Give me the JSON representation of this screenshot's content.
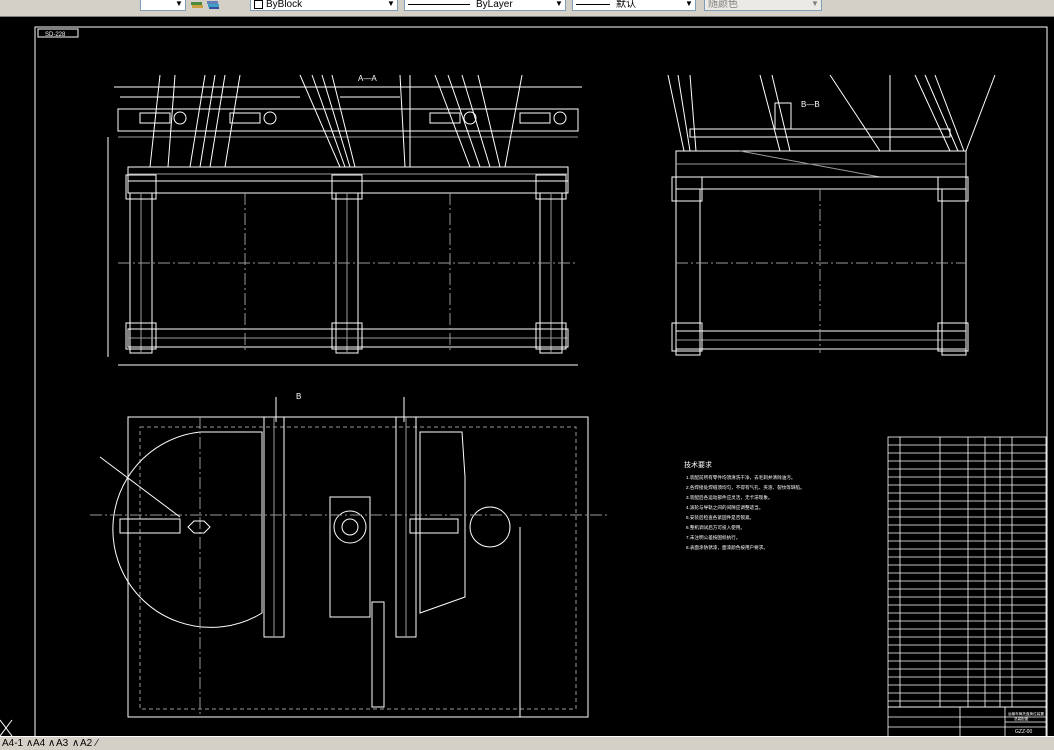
{
  "toolbar": {
    "layer_icons": [
      "layer-stack-icon",
      "layer-states-icon"
    ],
    "color_value": "ByBlock",
    "linetype_value": "ByLayer",
    "lineweight_value": "默认",
    "plotstyle_value": "随颜色"
  },
  "drawing": {
    "frame_tag": "SD-228",
    "section_aa": "A—A",
    "section_bb": "B—B",
    "section_marker": "B",
    "notes_title": "技术要求",
    "notes": [
      "1.装配前所有零件均须清洗干净，去毛刺并清除油污。",
      "2.各焊接处焊缝须均匀，不得有气孔、夹渣、裂纹等缺陷。",
      "3.装配后各运动部件应灵活，无卡滞现象。",
      "4.滚轮与导轨之间的间隙应调整适当。",
      "5.安装后检查各紧固件是否锁紧。",
      "6.整机调试后方可投入使用。",
      "7.未注明公差按国标执行。",
      "8.表面涂防锈漆，面漆颜色按用户要求。"
    ],
    "title_block": {
      "drawing_no": "GZZ-00",
      "name_line1": "运输车辆托盘换位装置",
      "name_line2": "总装配图"
    }
  },
  "tabs": [
    "A4-1",
    "A4",
    "A3",
    "A2"
  ],
  "colors": {
    "canvas": "#000000",
    "line_white": "#ffffff",
    "line_gray": "#9a9a9a",
    "ui_face": "#d4d0c8"
  }
}
